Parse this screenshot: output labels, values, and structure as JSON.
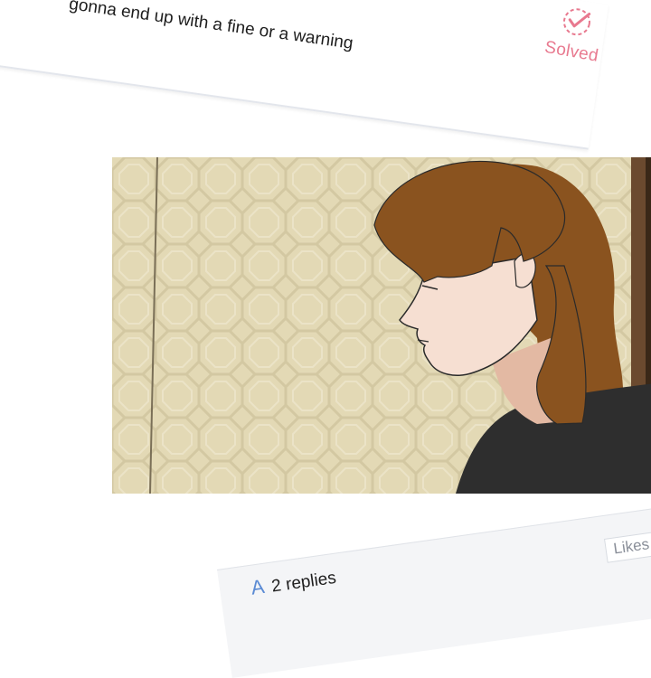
{
  "top_post": {
    "text": "gonna end up with a fine or a warning",
    "status_label": "Solved",
    "status_icon": "check-circle-icon",
    "status_color": "#e8798f"
  },
  "panel": {
    "wall_color": "#e3d9b5",
    "hair_color": "#8a531f",
    "skin_color": "#f6dfd2",
    "sweater_color": "#2e2e2e"
  },
  "reply_bar": {
    "icon": "answer-a-icon",
    "icon_letter": "A",
    "replies_label": "2 replies",
    "likes_label": "Likes"
  }
}
